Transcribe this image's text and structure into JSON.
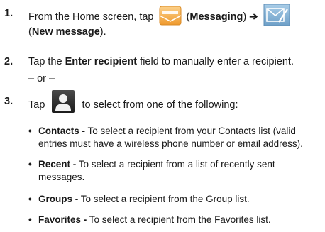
{
  "steps": {
    "s1": {
      "num": "1.",
      "pre": "From the Home screen, tap",
      "b1": "Messaging",
      "arrow": "➔",
      "b2": "New message",
      "icon1": "messaging-envelope-icon",
      "icon2": "new-message-icon"
    },
    "s2": {
      "num": "2.",
      "pre": "Tap the",
      "bold": "Enter recipient",
      "post": "field to manually enter a recipient."
    },
    "or": "– or –",
    "s3": {
      "num": "3.",
      "pre": "Tap",
      "post": "to select from one of the following:",
      "icon": "contact-person-icon"
    }
  },
  "bullets": [
    {
      "term": "Contacts -",
      "line1": "To select a recipient from your Contacts list (valid",
      "line2": "entries must have a wireless phone number or email address)."
    },
    {
      "term": "Recent -",
      "line1": "To select a recipient from a list of recently sent",
      "line2": "messages."
    },
    {
      "term": "Groups -",
      "line1": "To select a recipient from the Group list."
    },
    {
      "term": "Favorites -",
      "line1": "To select a recipient from the Favorites list."
    }
  ],
  "colors": {
    "icon_orange": "#f4a63a",
    "icon_blue": "#7fb0d8",
    "icon_dark": "#222222"
  }
}
